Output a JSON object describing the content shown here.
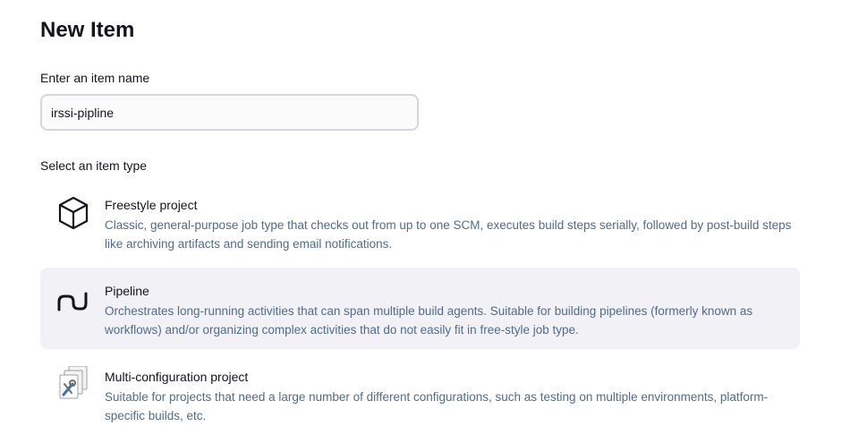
{
  "header": {
    "title": "New Item"
  },
  "name_field": {
    "label": "Enter an item name",
    "value": "irssi-pipline"
  },
  "type_section": {
    "label": "Select an item type"
  },
  "item_types": [
    {
      "title": "Freestyle project",
      "description": "Classic, general-purpose job type that checks out from up to one SCM, executes build steps serially, followed by post-build steps like archiving artifacts and sending email notifications.",
      "icon": "cube-icon",
      "selected": false
    },
    {
      "title": "Pipeline",
      "description": "Orchestrates long-running activities that can span multiple build agents. Suitable for building pipelines (formerly known as workflows) and/or organizing complex activities that do not easily fit in free-style job type.",
      "icon": "pipeline-icon",
      "selected": true
    },
    {
      "title": "Multi-configuration project",
      "description": "Suitable for projects that need a large number of different configurations, such as testing on multiple environments, platform-specific builds, etc.",
      "icon": "multi-configuration-icon",
      "selected": false
    }
  ],
  "colors": {
    "text": "#14141f",
    "description": "#4f6c8c",
    "selected_background": "#f2f2f6",
    "input_border": "#d6d6de"
  }
}
